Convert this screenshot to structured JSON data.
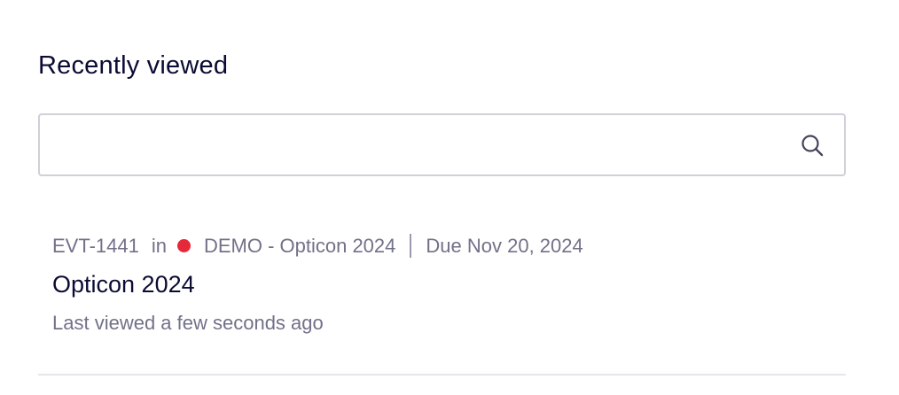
{
  "section": {
    "title": "Recently viewed"
  },
  "search": {
    "value": "",
    "placeholder": "",
    "icon": "search-icon"
  },
  "recent_items": [
    {
      "key": "EVT-1441",
      "in_word": "in",
      "project_color": "#e5283a",
      "project": "DEMO - Opticon 2024",
      "due": "Due Nov 20, 2024",
      "title": "Opticon 2024",
      "last_viewed": "Last viewed a few seconds ago"
    }
  ]
}
